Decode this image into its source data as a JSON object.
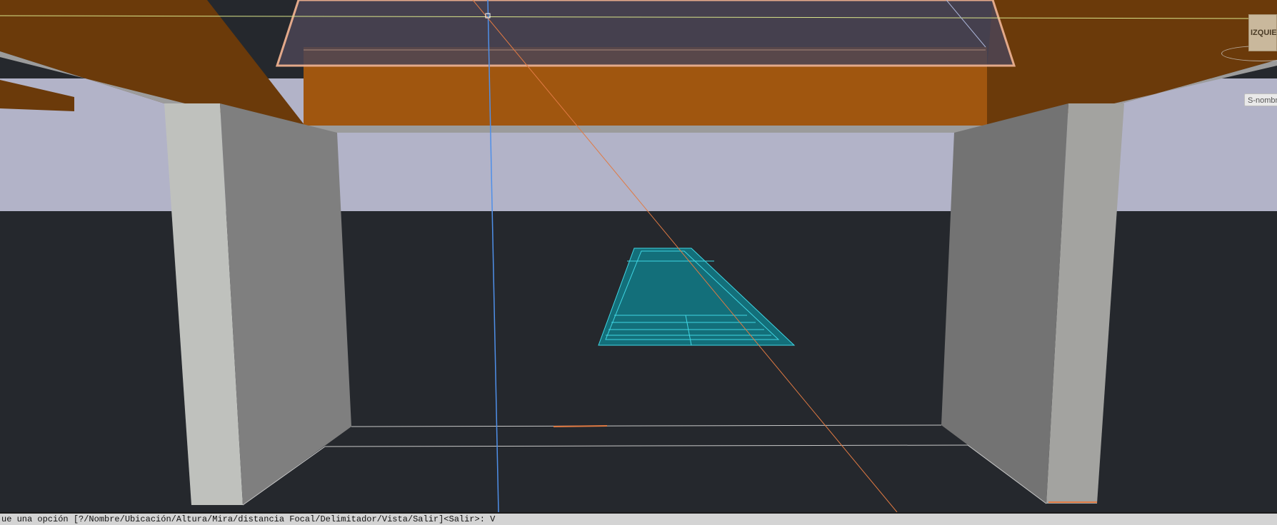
{
  "app": {
    "colors": {
      "background": "#25282d",
      "wall_light": "#bfc1bd",
      "wall_dark": "#7f7f7f",
      "beam": "#6b3a0a",
      "beam_highlight": "#a0560f",
      "sky_band": "#b2b3c8",
      "selection": "#2ab6c4",
      "crosshair_blue": "#4f8fe8",
      "crosshair_orange": "#e07a43",
      "glass": "#4b4455"
    }
  },
  "viewcube": {
    "face_label": "IZQUIERDA",
    "icon": "viewcube-icon"
  },
  "ucs": {
    "label": "S-nombre"
  },
  "command_line": {
    "text": "ue una opción [?/Nombre/Ubicación/Altura/Mira/distancia Focal/Delimitador/Vista/Salir]<Salir>: V"
  }
}
